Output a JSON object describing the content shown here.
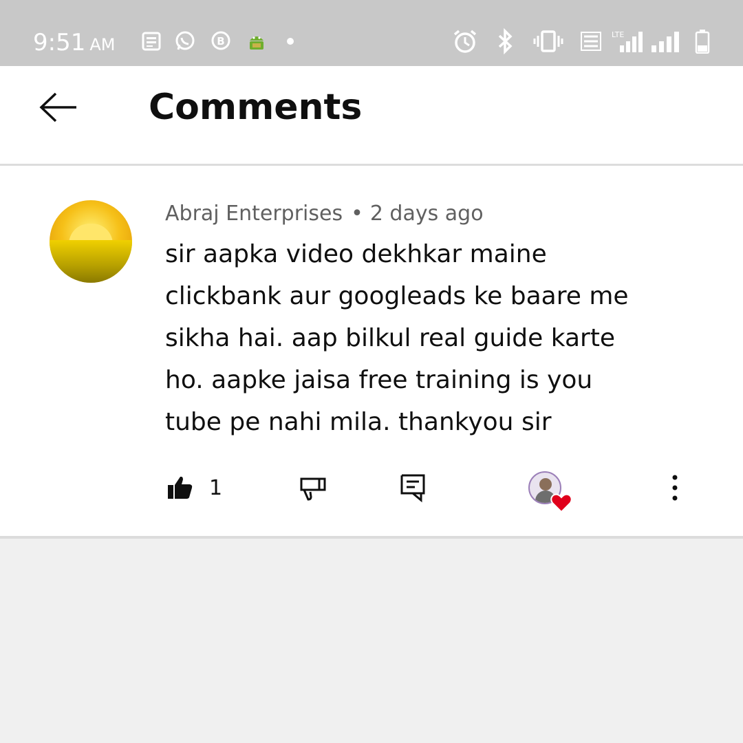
{
  "status_bar": {
    "time": "9:51",
    "ampm": "AM",
    "icons": [
      "news-icon",
      "whatsapp-icon",
      "business-icon",
      "android-icon",
      "dot-icon",
      "alarm-icon",
      "bluetooth-icon",
      "vibrate-icon",
      "volte-icon",
      "lte-signal-icon",
      "signal-icon",
      "battery-icon"
    ],
    "lte_label": "LTE"
  },
  "header": {
    "title": "Comments",
    "back_icon": "arrow-left-icon"
  },
  "comment": {
    "author": "Abraj Enterprises",
    "separator": "•",
    "time_ago": "2 days ago",
    "text": "sir aapka video dekhkar maine\nclickbank aur googleads ke baare me\nsikha hai. aap bilkul real guide karte\nho. aapke jaisa free training is you\ntube pe nahi mila. thankyou sir",
    "like_count": "1",
    "actions": {
      "like_icon": "thumbs-up-filled-icon",
      "dislike_icon": "thumbs-down-icon",
      "reply_icon": "reply-comment-icon",
      "creator_heart_icon": "heart-icon",
      "more_icon": "more-vertical-icon"
    }
  },
  "colors": {
    "status_bar_bg": "#c8c8c8",
    "page_bg": "#f0f0f0",
    "card_bg": "#ffffff",
    "text_primary": "#0f0f0f",
    "text_secondary": "#606060",
    "heart": "#e0001b"
  }
}
